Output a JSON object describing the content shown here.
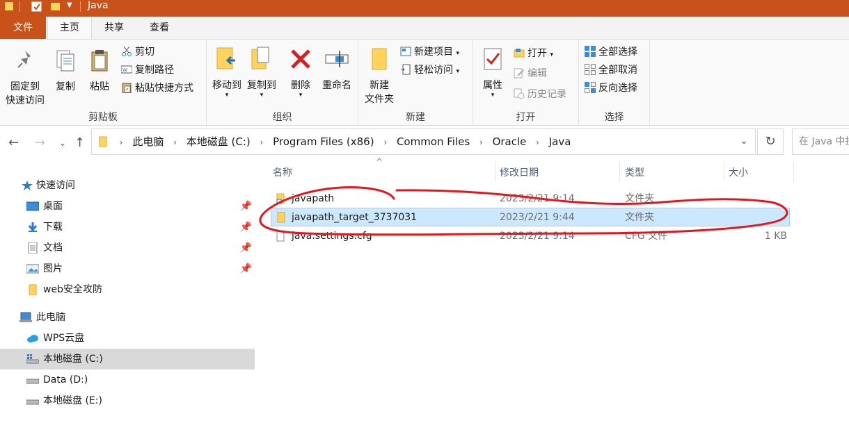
{
  "window": {
    "title": "Java"
  },
  "ribbon_tabs": {
    "file": "文件",
    "home": "主页",
    "share": "共享",
    "view": "查看"
  },
  "ribbon": {
    "clipboard": {
      "label": "剪贴板",
      "pin_line1": "固定到",
      "pin_line2": "快速访问",
      "copy": "复制",
      "paste": "粘贴",
      "cut": "剪切",
      "copy_path": "复制路径",
      "paste_shortcut": "粘贴快捷方式"
    },
    "organize": {
      "label": "组织",
      "move_to": "移动到",
      "copy_to": "复制到",
      "delete": "删除",
      "rename": "重命名"
    },
    "new": {
      "label": "新建",
      "new_folder_line1": "新建",
      "new_folder_line2": "文件夹",
      "new_item": "新建项目",
      "easy_access": "轻松访问"
    },
    "open": {
      "label": "打开",
      "properties": "属性",
      "open": "打开",
      "edit": "编辑",
      "history": "历史记录"
    },
    "select": {
      "label": "选择",
      "select_all": "全部选择",
      "select_none": "全部取消",
      "invert": "反向选择"
    }
  },
  "address": {
    "crumbs": [
      "此电脑",
      "本地磁盘 (C:)",
      "Program Files (x86)",
      "Common Files",
      "Oracle",
      "Java"
    ],
    "search_placeholder": "在 Java 中搜"
  },
  "sidebar": {
    "quick_access": "快速访问",
    "pinned": [
      "桌面",
      "下载",
      "文档",
      "图片"
    ],
    "folder": "web安全攻防",
    "this_pc": "此电脑",
    "drives": [
      "WPS云盘",
      "本地磁盘 (C:)",
      "Data (D:)",
      "本地磁盘 (E:)"
    ]
  },
  "columns": {
    "name": "名称",
    "date": "修改日期",
    "type": "类型",
    "size": "大小"
  },
  "files": [
    {
      "name": "javapath",
      "date": "2023/2/21 9:14",
      "type": "文件夹",
      "size": ""
    },
    {
      "name": "javapath_target_3737031",
      "date": "2023/2/21 9:44",
      "type": "文件夹",
      "size": ""
    },
    {
      "name": "java.settings.cfg",
      "date": "2023/2/21 9:14",
      "type": "CFG 文件",
      "size": "1 KB"
    }
  ],
  "colors": {
    "titlebar": "#c9511a",
    "selection": "#cce8ff",
    "annotation": "#e8141b"
  }
}
